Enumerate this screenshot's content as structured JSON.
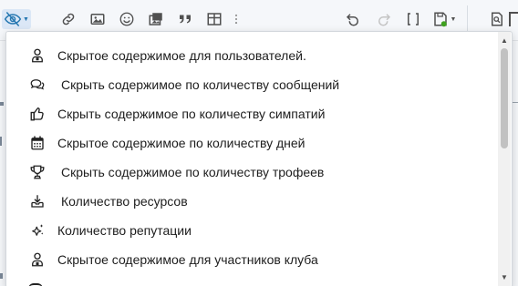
{
  "toolbar": {
    "icons": [
      "hide-content-icon",
      "link-icon",
      "image-icon",
      "smiley-icon",
      "media-icon",
      "quote-icon",
      "table-icon",
      "more-icon",
      "undo-icon",
      "redo-icon",
      "brackets-icon",
      "drafts-icon",
      "preview-icon"
    ],
    "accent": "#2577b1"
  },
  "menu": {
    "items": [
      {
        "label": "Скрытое содержимое для пользователей.",
        "icon": "user-lock-icon"
      },
      {
        "label": "Скрыть содержимое по количеству сообщений",
        "icon": "comments-icon"
      },
      {
        "label": "Скрыть содержимое по количеству симпатий",
        "icon": "thumbs-up-icon"
      },
      {
        "label": "Скрытое содержимое по количеству дней",
        "icon": "calendar-icon"
      },
      {
        "label": "Скрыть содержимое по количеству трофеев",
        "icon": "trophy-icon"
      },
      {
        "label": "Количество ресурсов",
        "icon": "download-tray-icon"
      },
      {
        "label": "Количество репутации",
        "icon": "sparkle-star-icon"
      },
      {
        "label": "Скрытое содержимое для участников клуба",
        "icon": "user-badge-icon"
      }
    ]
  }
}
